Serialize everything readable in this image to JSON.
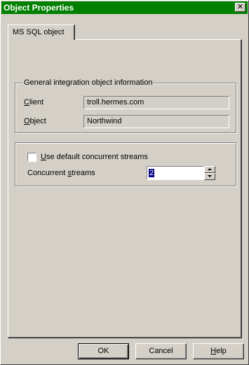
{
  "window": {
    "title": "Object Properties",
    "close_glyph": "✕"
  },
  "tabs": [
    {
      "label": "MS SQL object",
      "active": true
    }
  ],
  "general_group": {
    "title": "General integration object information",
    "client_label_pre": "",
    "client_label_u": "C",
    "client_label_post": "lient",
    "client_value": "troll.hermes.com",
    "object_label_pre": "",
    "object_label_u": "O",
    "object_label_post": "bject",
    "object_value": "Northwind"
  },
  "streams_group": {
    "checkbox_label_pre": "",
    "checkbox_label_u": "U",
    "checkbox_label_post": "se default concurrent streams",
    "checkbox_checked": false,
    "streams_label_pre": "Concurrent ",
    "streams_label_u": "s",
    "streams_label_post": "treams",
    "streams_value": "2"
  },
  "buttons": {
    "ok": "OK",
    "cancel": "Cancel",
    "help_u": "H",
    "help_post": "elp"
  }
}
